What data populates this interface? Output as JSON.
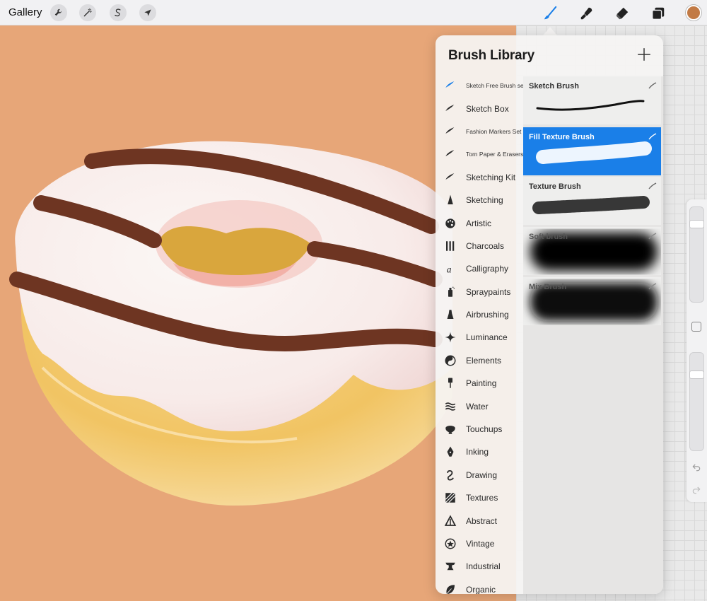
{
  "topbar": {
    "gallery_label": "Gallery",
    "left_tools": [
      {
        "icon": "wrench-icon",
        "name": "actions"
      },
      {
        "icon": "magic-wand-icon",
        "name": "adjustments"
      },
      {
        "icon": "selection-s-icon",
        "name": "selection"
      },
      {
        "icon": "cursor-arrow-icon",
        "name": "transform"
      }
    ],
    "right_tools": [
      {
        "icon": "brush-icon",
        "name": "paint",
        "active": true
      },
      {
        "icon": "smudge-icon",
        "name": "smudge"
      },
      {
        "icon": "eraser-icon",
        "name": "erase"
      },
      {
        "icon": "layers-icon",
        "name": "layers"
      }
    ],
    "current_color": "#c27a45",
    "accent_color": "#1a7fe8"
  },
  "panel": {
    "title": "Brush Library",
    "add_icon": "plus-icon",
    "sets": [
      {
        "label": "Sketch Free Brush set",
        "icon": "brush-stroke-icon",
        "selected": true,
        "small": true
      },
      {
        "label": "Sketch Box",
        "icon": "brush-stroke-icon"
      },
      {
        "label": "Fashion Markers Set",
        "icon": "brush-stroke-icon",
        "small": true
      },
      {
        "label": "Torn Paper & Erasers",
        "icon": "brush-stroke-icon",
        "small": true
      },
      {
        "label": "Sketching Kit",
        "icon": "brush-stroke-icon"
      },
      {
        "label": "Sketching",
        "icon": "pencil-tip-icon"
      },
      {
        "label": "Artistic",
        "icon": "palette-icon"
      },
      {
        "label": "Charcoals",
        "icon": "charcoal-sticks-icon"
      },
      {
        "label": "Calligraphy",
        "icon": "calligraphy-a-icon"
      },
      {
        "label": "Spraypaints",
        "icon": "spray-can-icon"
      },
      {
        "label": "Airbrushing",
        "icon": "airbrush-icon"
      },
      {
        "label": "Luminance",
        "icon": "sparkle-icon"
      },
      {
        "label": "Elements",
        "icon": "yin-yang-icon"
      },
      {
        "label": "Painting",
        "icon": "paint-brush-icon"
      },
      {
        "label": "Water",
        "icon": "waves-icon"
      },
      {
        "label": "Touchups",
        "icon": "shell-icon"
      },
      {
        "label": "Inking",
        "icon": "ink-nib-icon"
      },
      {
        "label": "Drawing",
        "icon": "squiggle-icon"
      },
      {
        "label": "Textures",
        "icon": "hatch-square-icon"
      },
      {
        "label": "Abstract",
        "icon": "triangle-icon"
      },
      {
        "label": "Vintage",
        "icon": "star-circle-icon"
      },
      {
        "label": "Industrial",
        "icon": "anvil-icon"
      },
      {
        "label": "Organic",
        "icon": "leaf-icon"
      }
    ],
    "brushes": [
      {
        "name": "Sketch Brush",
        "selected": false
      },
      {
        "name": "Fill Texture Brush",
        "selected": true
      },
      {
        "name": "Texture Brush",
        "selected": false
      },
      {
        "name": "Soft brush",
        "selected": false
      },
      {
        "name": "Mix Brush",
        "selected": false
      }
    ]
  },
  "sidebar": {
    "size_slider_value": 0.15,
    "opacity_slider_value": 0.2,
    "undo_icon": "undo-icon",
    "redo_icon": "redo-icon"
  }
}
